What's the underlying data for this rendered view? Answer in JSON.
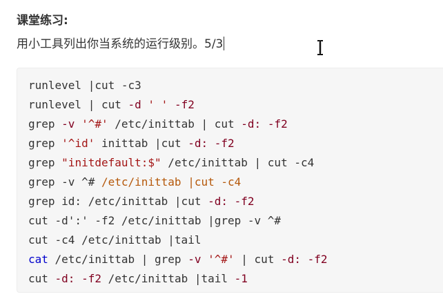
{
  "header": {
    "title": "课堂练习:",
    "instruction": "用小工具列出你当系统的运行级别。5/3"
  },
  "colors": {
    "code_background": "#f6f6f6",
    "text": "#333333",
    "string": "#a31515",
    "option": "#800020",
    "keyword": "#0000cc",
    "highlight": "#b5580a"
  },
  "cursor_icon": "i-beam-text-cursor-icon",
  "code": {
    "lines": [
      [
        {
          "t": "runlevel |cut -c3",
          "c": "plain"
        }
      ],
      [
        {
          "t": "runlevel | cut ",
          "c": "plain"
        },
        {
          "t": "-d",
          "c": "opt"
        },
        {
          "t": " ",
          "c": "plain"
        },
        {
          "t": "' '",
          "c": "str"
        },
        {
          "t": " ",
          "c": "plain"
        },
        {
          "t": "-f2",
          "c": "opt"
        }
      ],
      [
        {
          "t": "grep ",
          "c": "plain"
        },
        {
          "t": "-v",
          "c": "opt"
        },
        {
          "t": " ",
          "c": "plain"
        },
        {
          "t": "'^#'",
          "c": "str"
        },
        {
          "t": " /etc/inittab | cut ",
          "c": "plain"
        },
        {
          "t": "-d:",
          "c": "opt"
        },
        {
          "t": " ",
          "c": "plain"
        },
        {
          "t": "-f2",
          "c": "opt"
        }
      ],
      [
        {
          "t": "grep ",
          "c": "plain"
        },
        {
          "t": "'^id'",
          "c": "str"
        },
        {
          "t": " inittab |cut ",
          "c": "plain"
        },
        {
          "t": "-d:",
          "c": "opt"
        },
        {
          "t": " ",
          "c": "plain"
        },
        {
          "t": "-f2",
          "c": "opt"
        }
      ],
      [
        {
          "t": "grep ",
          "c": "plain"
        },
        {
          "t": "\"initdefault:$\"",
          "c": "str"
        },
        {
          "t": " /etc/inittab | cut -c4",
          "c": "plain"
        }
      ],
      [
        {
          "t": "grep -v ^# ",
          "c": "plain"
        },
        {
          "t": "/etc/inittab |cut -c4",
          "c": "var"
        }
      ],
      [
        {
          "t": "grep id: /etc/inittab |cut ",
          "c": "plain"
        },
        {
          "t": "-d:",
          "c": "opt"
        },
        {
          "t": " ",
          "c": "plain"
        },
        {
          "t": "-f2",
          "c": "opt"
        }
      ],
      [
        {
          "t": "cut -d':' -f2 /etc/inittab |grep -v ^#",
          "c": "plain"
        }
      ],
      [
        {
          "t": "cut -c4 /etc/inittab |tail",
          "c": "plain"
        }
      ],
      [
        {
          "t": "cat",
          "c": "kw"
        },
        {
          "t": " /etc/inittab | grep ",
          "c": "plain"
        },
        {
          "t": "-v",
          "c": "opt"
        },
        {
          "t": " ",
          "c": "plain"
        },
        {
          "t": "'^#'",
          "c": "str"
        },
        {
          "t": " | cut ",
          "c": "plain"
        },
        {
          "t": "-d:",
          "c": "opt"
        },
        {
          "t": " ",
          "c": "plain"
        },
        {
          "t": "-f2",
          "c": "opt"
        }
      ],
      [
        {
          "t": "cut ",
          "c": "plain"
        },
        {
          "t": "-d:",
          "c": "opt"
        },
        {
          "t": " ",
          "c": "plain"
        },
        {
          "t": "-f2",
          "c": "opt"
        },
        {
          "t": " /etc/inittab |tail ",
          "c": "plain"
        },
        {
          "t": "-1",
          "c": "opt"
        }
      ]
    ]
  }
}
